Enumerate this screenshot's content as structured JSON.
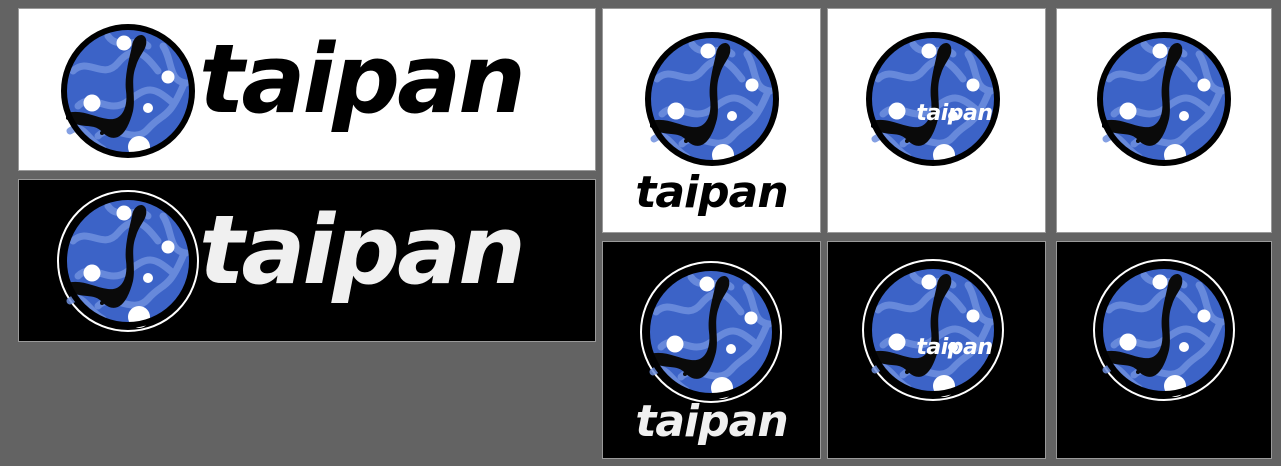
{
  "brand": {
    "wordmark": "taipan",
    "colors": {
      "background": "#636363",
      "disc_blue": "#3c63c7",
      "disc_pattern": "#6f90df",
      "outline": "#000000",
      "light_tile": "#ffffff",
      "dark_tile": "#000000",
      "dark_ring": "#ffffff"
    }
  },
  "variants": [
    {
      "name": "horizontal-on-light",
      "background": "light",
      "wordmark": "taipan"
    },
    {
      "name": "horizontal-on-dark",
      "background": "dark",
      "wordmark": "taipan"
    },
    {
      "name": "stacked-on-light",
      "background": "light",
      "wordmark": "taipan"
    },
    {
      "name": "overlay-on-light",
      "background": "light",
      "wordmark": "taipan"
    },
    {
      "name": "icon-only-on-light",
      "background": "light"
    },
    {
      "name": "stacked-on-dark",
      "background": "dark",
      "wordmark": "taipan"
    },
    {
      "name": "overlay-on-dark",
      "background": "dark",
      "wordmark": "taipan"
    },
    {
      "name": "icon-only-on-dark",
      "background": "dark"
    }
  ]
}
